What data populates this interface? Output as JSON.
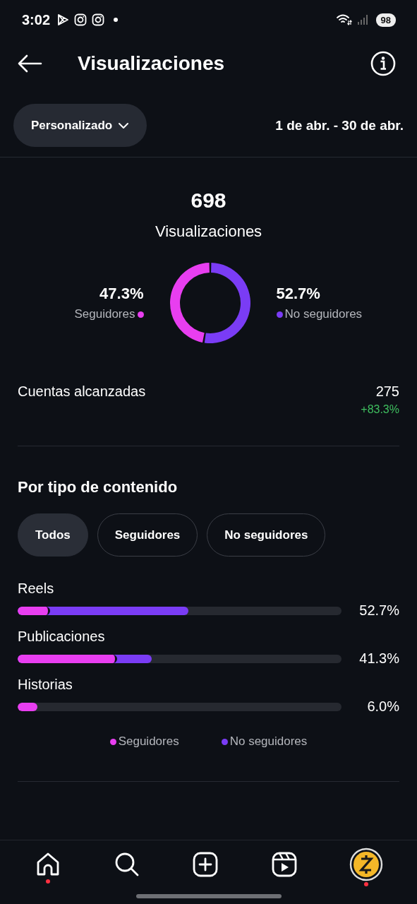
{
  "status_bar": {
    "time": "3:02",
    "battery": "98"
  },
  "header": {
    "title": "Visualizaciones"
  },
  "filter": {
    "label": "Personalizado",
    "date_range": "1 de abr. - 30 de abr."
  },
  "summary": {
    "total": "698",
    "label": "Visualizaciones",
    "legend": [
      {
        "value": "47.3%",
        "label": "Seguidores",
        "color": "#e83ef0"
      },
      {
        "value": "52.7%",
        "label": "No seguidores",
        "color": "#7a3cf5"
      }
    ],
    "chart_data": {
      "type": "donut",
      "values": [
        47.3,
        52.7
      ]
    }
  },
  "reach": {
    "label": "Cuentas alcanzadas",
    "value": "275",
    "change": "+83.3%"
  },
  "content_type": {
    "title": "Por tipo de contenido",
    "chips": [
      {
        "label": "Todos",
        "selected": true
      },
      {
        "label": "Seguidores",
        "selected": false
      },
      {
        "label": "No seguidores",
        "selected": false
      }
    ],
    "rows": [
      {
        "label": "Reels",
        "followers": {
          "level": 0.1
        },
        "total": {
          "level": 0.527
        },
        "reading": "52.7%"
      },
      {
        "label": "Publicaciones",
        "followers": {
          "level": 0.307
        },
        "total": {
          "level": 0.413
        },
        "reading": "41.3%"
      },
      {
        "label": "Historias",
        "followers": {
          "level": 0.06
        },
        "reading": "6.0%"
      }
    ],
    "legend": [
      {
        "label": "Seguidores",
        "color": "#e83ef0"
      },
      {
        "label": "No seguidores",
        "color": "#7a3cf5"
      }
    ]
  },
  "nav": [
    {
      "kind": "home",
      "badge": true
    },
    {
      "kind": "search"
    },
    {
      "kind": "create"
    },
    {
      "kind": "reels"
    },
    {
      "kind": "profile",
      "badge": true
    }
  ]
}
